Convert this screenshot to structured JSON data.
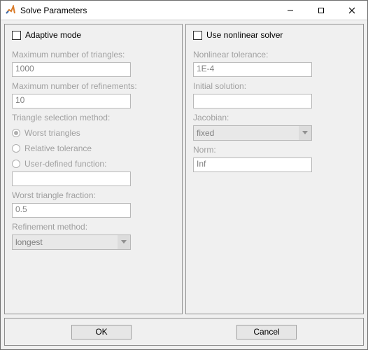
{
  "window": {
    "title": "Solve Parameters"
  },
  "left": {
    "adaptive_label": "Adaptive mode",
    "max_triangles_label": "Maximum number of triangles:",
    "max_triangles_value": "1000",
    "max_refinements_label": "Maximum number of refinements:",
    "max_refinements_value": "10",
    "selection_method_label": "Triangle selection method:",
    "radio_worst": "Worst triangles",
    "radio_reltol": "Relative tolerance",
    "radio_udf": "User-defined function:",
    "udf_value": "",
    "worst_fraction_label": "Worst triangle fraction:",
    "worst_fraction_value": "0.5",
    "refinement_method_label": "Refinement method:",
    "refinement_method_value": "longest"
  },
  "right": {
    "nonlinear_label": "Use nonlinear solver",
    "tolerance_label": "Nonlinear tolerance:",
    "tolerance_value": "1E-4",
    "initial_label": "Initial solution:",
    "initial_value": "",
    "jacobian_label": "Jacobian:",
    "jacobian_value": "fixed",
    "norm_label": "Norm:",
    "norm_value": "Inf"
  },
  "buttons": {
    "ok": "OK",
    "cancel": "Cancel"
  }
}
